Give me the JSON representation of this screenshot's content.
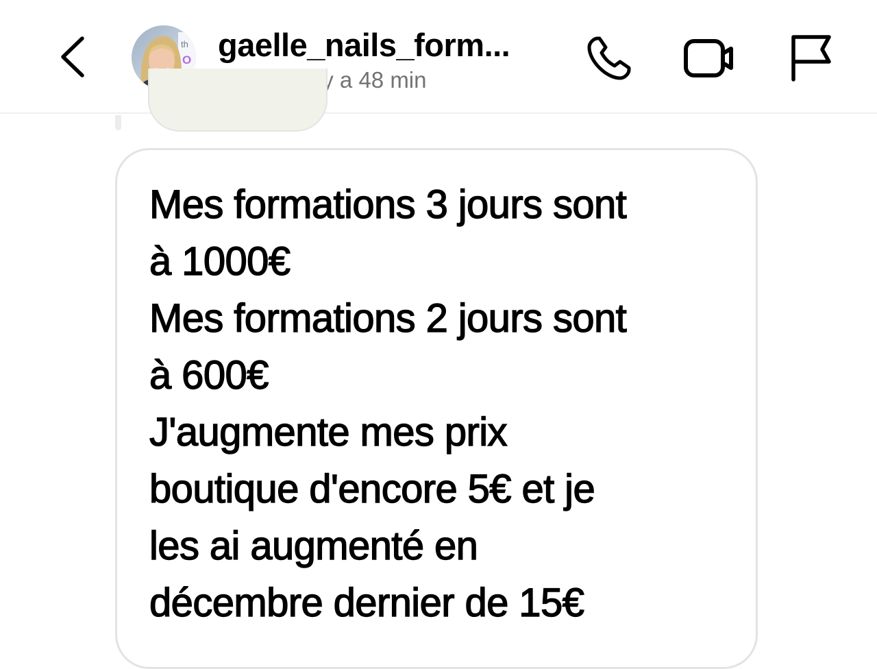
{
  "header": {
    "username": "gaelle_nails_form...",
    "status": "En ligne il y a 48 min",
    "icons": {
      "back": "chevron-left-icon",
      "call": "phone-icon",
      "video": "video-camera-icon",
      "report": "flag-icon"
    }
  },
  "message": {
    "lines": [
      "Mes formations 3 jours sont",
      "à 1000€",
      "Mes formations 2 jours sont",
      "à 600€",
      "J'augmente mes prix",
      "boutique d'encore 5€ et je",
      "les ai augmenté en",
      "décembre dernier de 15€"
    ]
  },
  "colors": {
    "text": "#000000",
    "secondary_text": "#737373",
    "bubble_border": "#e3e3e3",
    "divider": "#efefef"
  }
}
